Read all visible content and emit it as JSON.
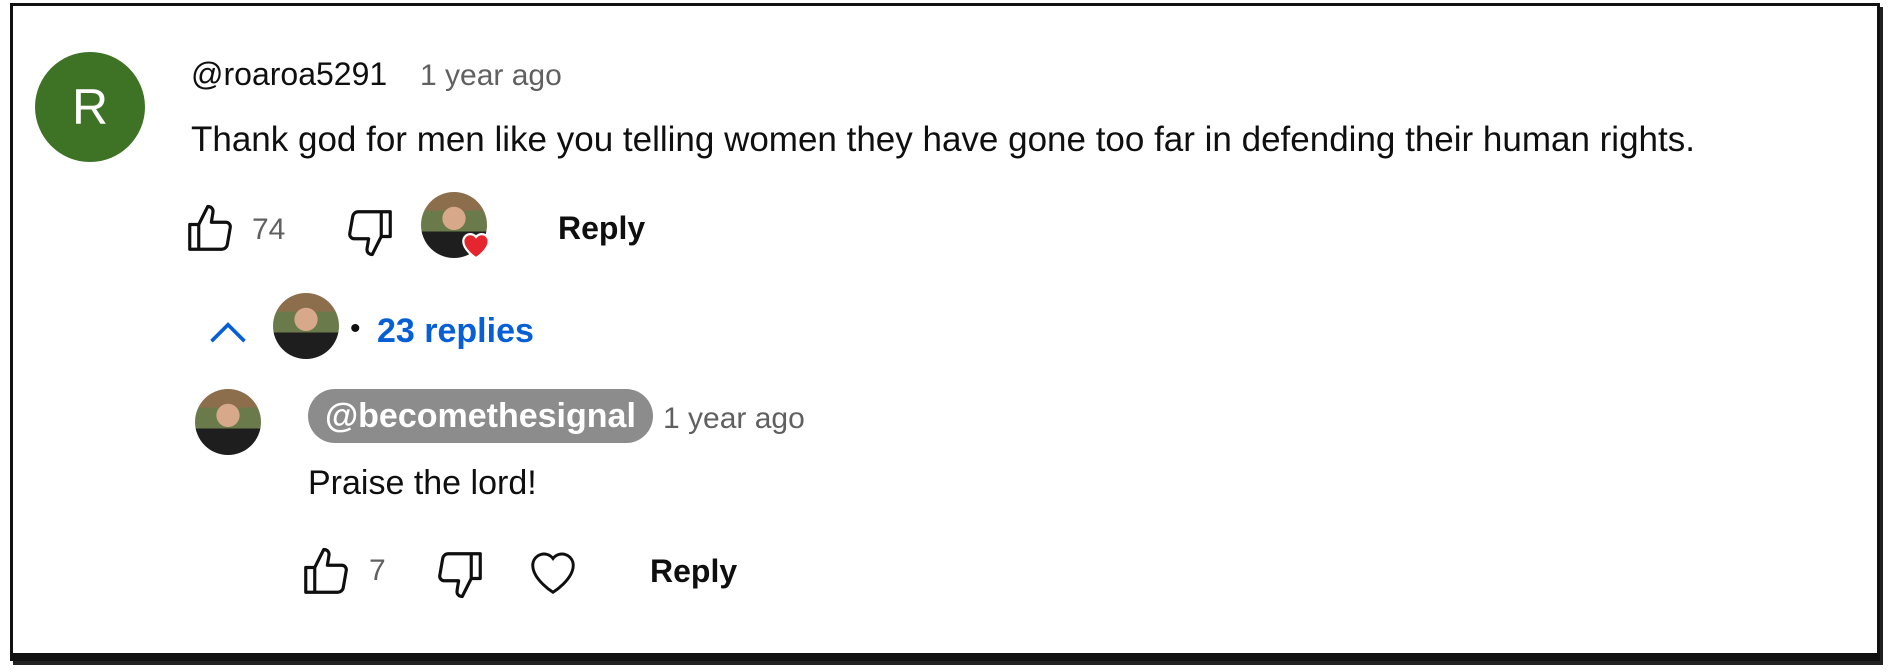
{
  "comment": {
    "avatar_letter": "R",
    "handle": "@roaroa5291",
    "time": "1 year ago",
    "text": "Thank god for men like you telling women they have gone too far in defending their human rights.",
    "likes": "74",
    "reply_label": "Reply",
    "hearted_by_creator": true
  },
  "thread": {
    "replies_label": "23 replies",
    "separator": "•",
    "expanded": true
  },
  "reply": {
    "handle": "@becomethesignal",
    "time": "1 year ago",
    "text": "Praise the lord!",
    "likes": "7",
    "reply_label": "Reply"
  },
  "colors": {
    "avatar_bg": "#3e7326",
    "link_blue": "#065fd4",
    "creator_chip": "#8c8c8c",
    "heart_red": "#e5262f",
    "muted_text": "#606060"
  },
  "icons": [
    "like-icon",
    "dislike-icon",
    "heart-icon",
    "chevron-up-icon"
  ]
}
